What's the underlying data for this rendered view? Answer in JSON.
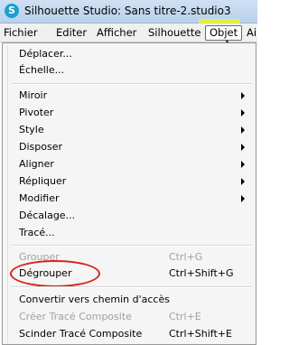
{
  "window": {
    "title": "Silhouette Studio: Sans titre-2.studio3",
    "icon_glyph": "S"
  },
  "menubar": {
    "items": [
      "Fichier",
      "Editer",
      "Afficher",
      "Silhouette",
      "Objet",
      "Ai"
    ],
    "selected": "Objet"
  },
  "menu": {
    "items": [
      {
        "label": "Déplacer...",
        "shortcut": "",
        "submenu": false,
        "enabled": true
      },
      {
        "label": "Échelle...",
        "shortcut": "",
        "submenu": false,
        "enabled": true
      },
      {
        "label": "Miroir",
        "shortcut": "",
        "submenu": true,
        "enabled": true
      },
      {
        "label": "Pivoter",
        "shortcut": "",
        "submenu": true,
        "enabled": true
      },
      {
        "label": "Style",
        "shortcut": "",
        "submenu": true,
        "enabled": true
      },
      {
        "label": "Disposer",
        "shortcut": "",
        "submenu": true,
        "enabled": true
      },
      {
        "label": "Aligner",
        "shortcut": "",
        "submenu": true,
        "enabled": true
      },
      {
        "label": "Répliquer",
        "shortcut": "",
        "submenu": true,
        "enabled": true
      },
      {
        "label": "Modifier",
        "shortcut": "",
        "submenu": true,
        "enabled": true
      },
      {
        "label": "Décalage...",
        "shortcut": "",
        "submenu": false,
        "enabled": true
      },
      {
        "label": "Tracé...",
        "shortcut": "",
        "submenu": false,
        "enabled": true
      },
      {
        "label": "Grouper",
        "shortcut": "Ctrl+G",
        "submenu": false,
        "enabled": false
      },
      {
        "label": "Dégrouper",
        "shortcut": "Ctrl+Shift+G",
        "submenu": false,
        "enabled": true
      },
      {
        "label": "Convertir vers chemin d'accès",
        "shortcut": "",
        "submenu": false,
        "enabled": true
      },
      {
        "label": "Créer Tracé Composite",
        "shortcut": "Ctrl+E",
        "submenu": false,
        "enabled": false
      },
      {
        "label": "Scinder Tracé Composite",
        "shortcut": "Ctrl+Shift+E",
        "submenu": false,
        "enabled": true
      }
    ]
  },
  "colors": {
    "annotation_circle": "#d9211f",
    "highlight": "#ebf528",
    "title_bar": "#c4d8ef"
  }
}
